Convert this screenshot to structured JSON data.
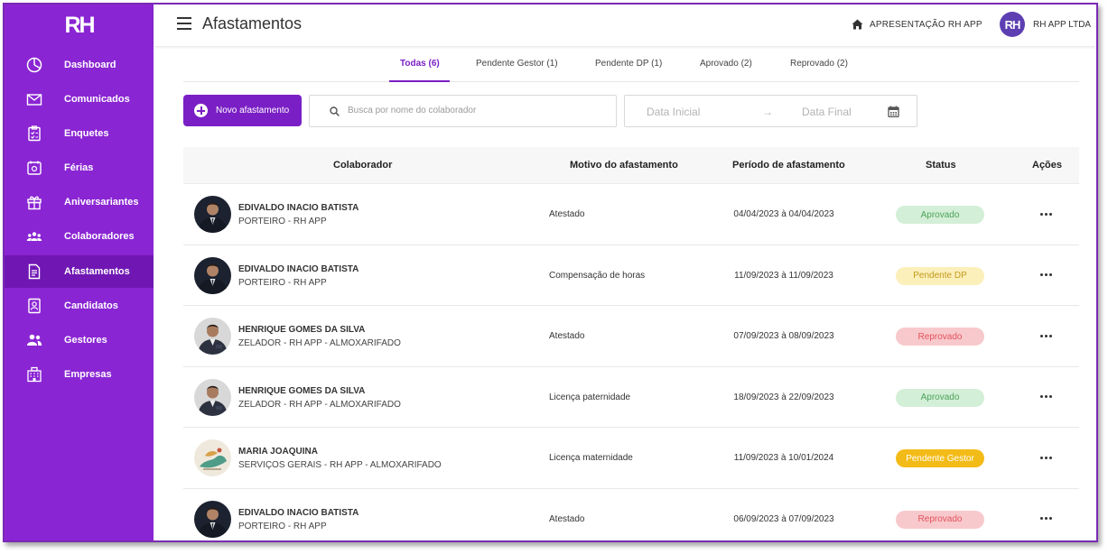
{
  "app": {
    "logo_text": "RH"
  },
  "sidebar": {
    "items": [
      {
        "label": "Dashboard",
        "icon": "pie-chart-icon",
        "active": false
      },
      {
        "label": "Comunicados",
        "icon": "envelope-icon",
        "active": false
      },
      {
        "label": "Enquetes",
        "icon": "clipboard-icon",
        "active": false
      },
      {
        "label": "Férias",
        "icon": "vacation-icon",
        "active": false
      },
      {
        "label": "Aniversariantes",
        "icon": "gift-icon",
        "active": false
      },
      {
        "label": "Colaboradores",
        "icon": "people-group-icon",
        "active": false
      },
      {
        "label": "Afastamentos",
        "icon": "document-icon",
        "active": true
      },
      {
        "label": "Candidatos",
        "icon": "candidate-card-icon",
        "active": false
      },
      {
        "label": "Gestores",
        "icon": "users-icon",
        "active": false
      },
      {
        "label": "Empresas",
        "icon": "building-icon",
        "active": false
      }
    ]
  },
  "header": {
    "title": "Afastamentos",
    "home_label": "APRESENTAÇÃO RH APP",
    "avatar_text": "RH",
    "company_label": "RH APP LTDA"
  },
  "tabs": [
    {
      "label": "Todas (6)",
      "active": true
    },
    {
      "label": "Pendente Gestor (1)",
      "active": false
    },
    {
      "label": "Pendente DP (1)",
      "active": false
    },
    {
      "label": "Aprovado (2)",
      "active": false
    },
    {
      "label": "Reprovado (2)",
      "active": false
    }
  ],
  "toolbar": {
    "new_button_label": "Novo afastamento",
    "search_placeholder": "Busca por nome do colaborador",
    "date_start_placeholder": "Data Inicial",
    "date_arrow": "→",
    "date_end_placeholder": "Data Final"
  },
  "table": {
    "columns": [
      "Colaborador",
      "Motivo do afastamento",
      "Período de afastamento",
      "Status",
      "Ações"
    ],
    "rows": [
      {
        "name": "EDIVALDO INACIO BATISTA",
        "role": "PORTEIRO - RH APP",
        "reason": "Atestado",
        "period": "04/04/2023 à 04/04/2023",
        "status": "Aprovado",
        "photo": "man-suit"
      },
      {
        "name": "EDIVALDO INACIO BATISTA",
        "role": "PORTEIRO - RH APP",
        "reason": "Compensação de horas",
        "period": "11/09/2023 à 11/09/2023",
        "status": "Pendente DP",
        "photo": "man-suit"
      },
      {
        "name": "HENRIQUE GOMES DA SILVA",
        "role": "ZELADOR - RH APP - ALMOXARIFADO",
        "reason": "Atestado",
        "period": "07/09/2023 à 08/09/2023",
        "status": "Reprovado",
        "photo": "man-suit-gray"
      },
      {
        "name": "HENRIQUE GOMES DA SILVA",
        "role": "ZELADOR - RH APP - ALMOXARIFADO",
        "reason": "Licença paternidade",
        "period": "18/09/2023 à 22/09/2023",
        "status": "Aprovado",
        "photo": "man-suit-gray"
      },
      {
        "name": "MARIA JOAQUINA",
        "role": "SERVIÇOS GERAIS - RH APP - ALMOXARIFADO",
        "reason": "Licença maternidade",
        "period": "11/09/2023 à 10/01/2024",
        "status": "Pendente Gestor",
        "photo": "illustration"
      },
      {
        "name": "EDIVALDO INACIO BATISTA",
        "role": "PORTEIRO - RH APP",
        "reason": "Atestado",
        "period": "06/09/2023 à 07/09/2023",
        "status": "Reprovado",
        "photo": "man-suit"
      }
    ]
  },
  "status_styles": {
    "Aprovado": {
      "bg": "#d3efd7",
      "color": "#4ca35a"
    },
    "Pendente DP": {
      "bg": "#fbefba",
      "color": "#c49a1a"
    },
    "Reprovado": {
      "bg": "#f8c9cc",
      "color": "#e2525c"
    },
    "Pendente Gestor": {
      "bg": "#f3bb17",
      "color": "#ffffff"
    }
  },
  "colors": {
    "accent": "#7a1fc5",
    "sidebar": "#8a25d3",
    "sidebar_active": "#7017b3"
  }
}
